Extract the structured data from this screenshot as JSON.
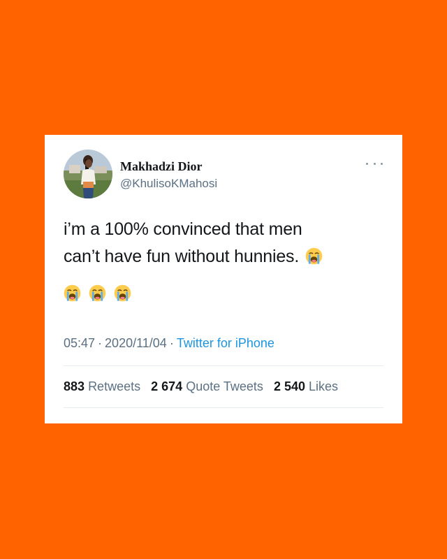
{
  "tweet": {
    "author": {
      "name": "Makhadzi Dior",
      "handle": "@KhulisoKMahosi"
    },
    "text_line1": "i’m a 100% convinced that men",
    "text_line2": "can’t have fun without hunnies.",
    "emojis": [
      "loudly-crying-face",
      "loudly-crying-face",
      "loudly-crying-face",
      "loudly-crying-face"
    ],
    "time": "05:47",
    "separator": "·",
    "date": "2020/11/04",
    "source": "Twitter for iPhone",
    "stats": {
      "retweets_count": "883",
      "retweets_label": "Retweets",
      "quotes_count": "2 674",
      "quotes_label": "Quote Tweets",
      "likes_count": "2 540",
      "likes_label": "Likes"
    }
  },
  "colors": {
    "background": "#ff6300",
    "card": "#ffffff",
    "text_primary": "#14171a",
    "text_secondary": "#5b7083",
    "link": "#1b95e0",
    "divider": "#e6ecf0"
  },
  "icons": {
    "more": "more-horizontal-icon"
  }
}
